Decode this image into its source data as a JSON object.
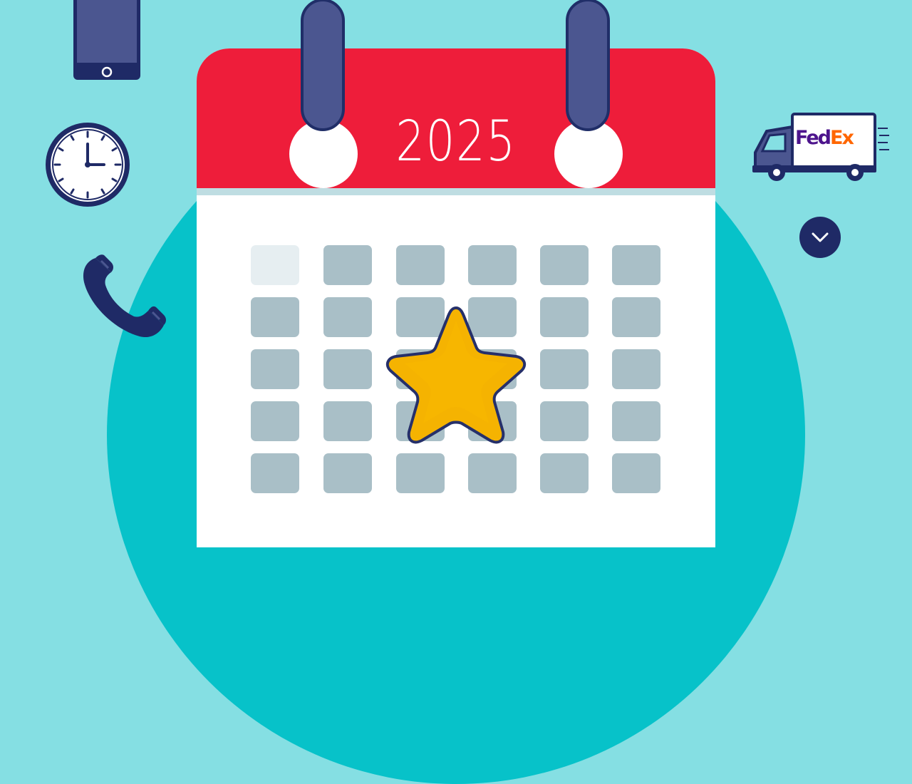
{
  "calendar": {
    "year": "2025",
    "grid": {
      "rows": 5,
      "columns": 6,
      "highlighted_cell": "row-1-col-1",
      "starred_cell": "row-3-col-3"
    }
  },
  "icons": {
    "phone_device": "smartphone-icon",
    "clock": "clock-icon",
    "telephone": "telephone-handset-icon",
    "delivery_truck": "delivery-truck-icon",
    "truck_logo_text": "FedEx",
    "dropdown": "chevron-down-icon",
    "star": "star-icon"
  },
  "colors": {
    "background": "#85dfe3",
    "circle": "#07c2c9",
    "calendar_header": "#ee1d3a",
    "ring": "#4b5690",
    "cell": "#a9bfc7",
    "star": "#f5b301",
    "navy": "#1f2a66"
  }
}
